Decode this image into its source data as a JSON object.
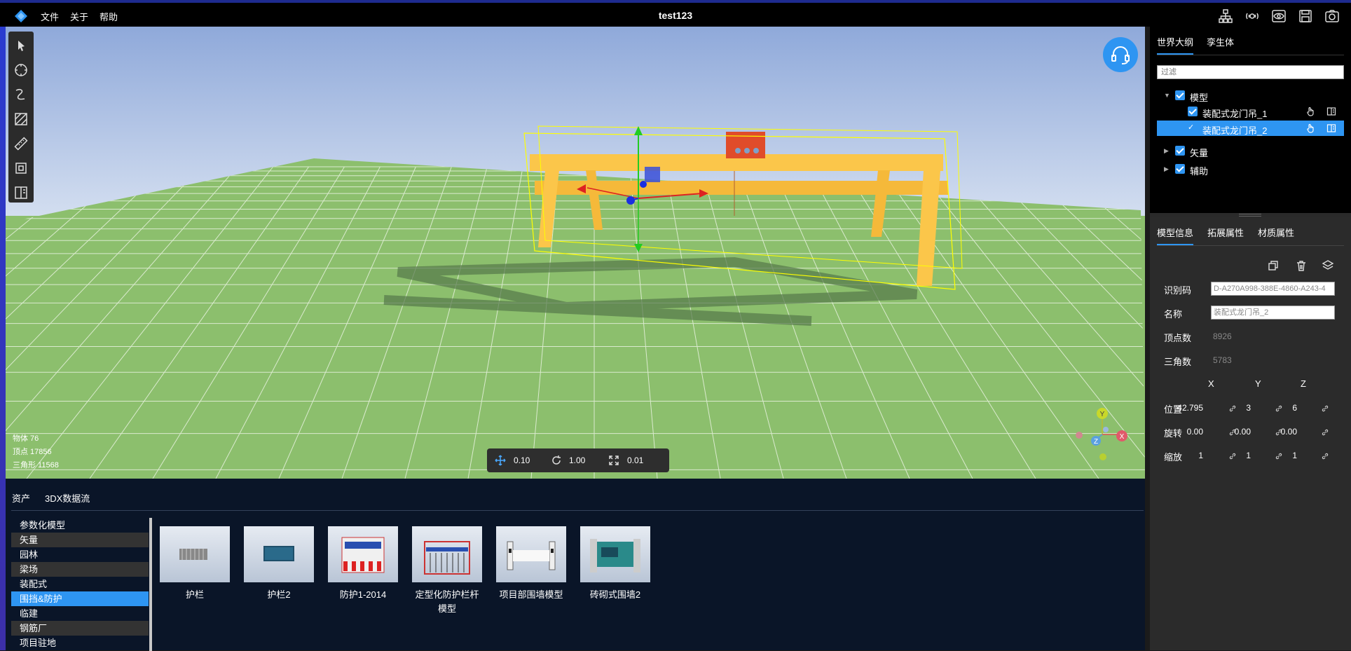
{
  "app": {
    "title": "test123",
    "menu": [
      "文件",
      "关于",
      "帮助"
    ]
  },
  "top_icons": [
    "hierarchy-icon",
    "network-icon",
    "eye-icon",
    "save-icon",
    "camera-icon"
  ],
  "viewport": {
    "stats": {
      "objects": "物体 76",
      "vertices": "顶点 17856",
      "triangles": "三角形 11568"
    },
    "transform": {
      "move": "0.10",
      "rotate": "1.00",
      "scale": "0.01"
    },
    "gizmo_axes": [
      "Y",
      "Z",
      "X"
    ],
    "colors": {
      "sky": "#a9c0e8",
      "ground": "#8cbf6d",
      "crane": "#fbc64a",
      "selection": "#ffff00",
      "accent": "#2e95f2"
    }
  },
  "tools": [
    "select-icon",
    "circle-icon",
    "curve-icon",
    "area-icon",
    "ruler-icon",
    "frame-icon",
    "split-icon"
  ],
  "bottom": {
    "tabs": [
      "资产",
      "3DX数据流"
    ],
    "categories": [
      "参数化模型",
      "矢量",
      "园林",
      "梁场",
      "装配式",
      "围挡&防护",
      "临建",
      "钢筋厂",
      "项目驻地"
    ],
    "selected_category": "围挡&防护",
    "assets": [
      {
        "name": "护栏"
      },
      {
        "name": "护栏2"
      },
      {
        "name": "防护1-2014"
      },
      {
        "name": "定型化防护栏杆模型"
      },
      {
        "name": "项目部围墙模型"
      },
      {
        "name": "砖砌式围墙2"
      }
    ]
  },
  "outline": {
    "tabs": [
      "世界大纲",
      "孪生体"
    ],
    "filter_placeholder": "过滤",
    "tree": [
      {
        "label": "模型",
        "expanded": true
      },
      {
        "label": "装配式龙门吊_1"
      },
      {
        "label": "装配式龙门吊_2",
        "selected": true
      },
      {
        "label": "矢量"
      },
      {
        "label": "辅助"
      }
    ]
  },
  "properties": {
    "tabs": [
      "模型信息",
      "拓展属性",
      "材质属性"
    ],
    "id_label": "识别码",
    "id_value": "D-A270A998-388E-4860-A243-4",
    "name_label": "名称",
    "name_value": "装配式龙门吊_2",
    "vertex_label": "顶点数",
    "vertex_value": "8926",
    "tri_label": "三角数",
    "tri_value": "5783",
    "axes": [
      "X",
      "Y",
      "Z"
    ],
    "position_label": "位置",
    "position": [
      "42.795",
      "3",
      "6"
    ],
    "rotation_label": "旋转",
    "rotation": [
      "0.00",
      "0.00",
      "0.00"
    ],
    "scale_label": "缩放",
    "scale": [
      "1",
      "1",
      "1"
    ]
  }
}
